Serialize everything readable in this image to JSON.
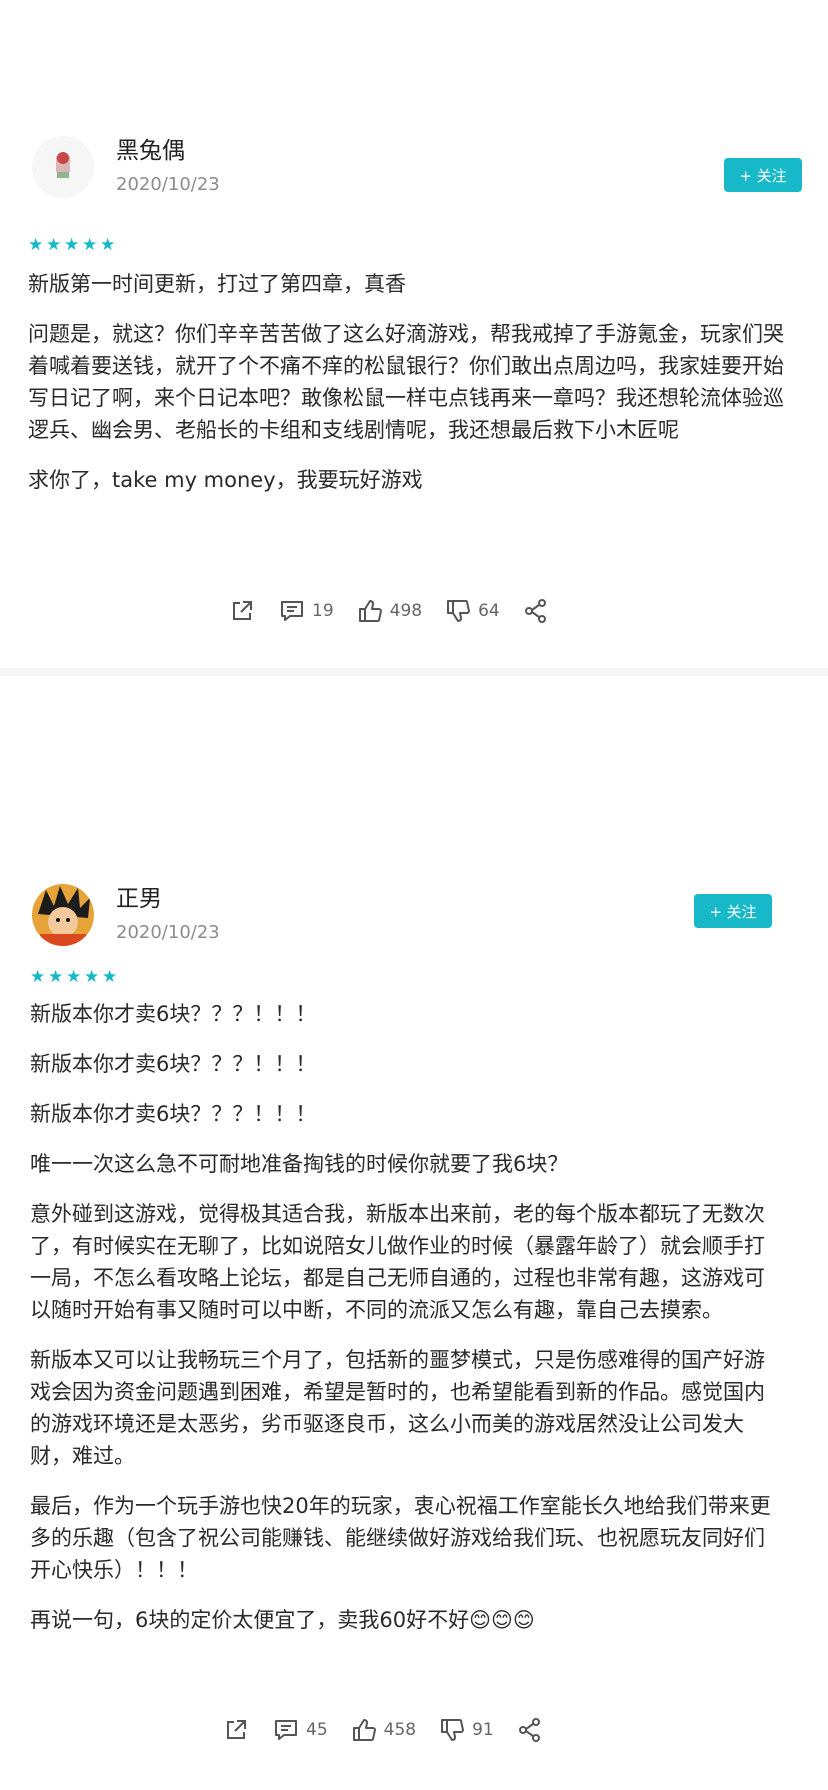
{
  "reviews": [
    {
      "author": "黑兔偶",
      "date": "2020/10/23",
      "follow_label": "+ 关注",
      "rating": 5,
      "paragraphs": [
        "新版第一时间更新，打过了第四章，真香",
        "问题是，就这？你们辛辛苦苦做了这么好滴游戏，帮我戒掉了手游氪金，玩家们哭着喊着要送钱，就开了个不痛不痒的松鼠银行？你们敢出点周边吗，我家娃要开始写日记了啊，来个日记本吧？敢像松鼠一样屯点钱再来一章吗？我还想轮流体验巡逻兵、幽会男、老船长的卡组和支线剧情呢，我还想最后救下小木匠呢",
        "求你了，take my money，我要玩好游戏"
      ],
      "stats": {
        "comments": "19",
        "likes": "498",
        "dislikes": "64"
      }
    },
    {
      "author": "正男",
      "date": "2020/10/23",
      "follow_label": "+ 关注",
      "rating": 5,
      "paragraphs": [
        "新版本你才卖6块？？？！！！",
        "新版本你才卖6块？？？！！！",
        "新版本你才卖6块？？？！！！",
        "唯一一次这么急不可耐地准备掏钱的时候你就要了我6块？",
        "意外碰到这游戏，觉得极其适合我，新版本出来前，老的每个版本都玩了无数次了，有时候实在无聊了，比如说陪女儿做作业的时候（暴露年龄了）就会顺手打一局，不怎么看攻略上论坛，都是自己无师自通的，过程也非常有趣，这游戏可以随时开始有事又随时可以中断，不同的流派又怎么有趣，靠自己去摸索。",
        "新版本又可以让我畅玩三个月了，包括新的噩梦模式，只是伤感难得的国产好游戏会因为资金问题遇到困难，希望是暂时的，也希望能看到新的作品。感觉国内的游戏环境还是太恶劣，劣币驱逐良币，这么小而美的游戏居然没让公司发大财，难过。",
        "最后，作为一个玩手游也快20年的玩家，衷心祝福工作室能长久地给我们带来更多的乐趣（包含了祝公司能赚钱、能继续做好游戏给我们玩、也祝愿玩友同好们开心快乐）！！！",
        "再说一句，6块的定价太便宜了，卖我60好不好😊😊😊"
      ],
      "stats": {
        "comments": "45",
        "likes": "458",
        "dislikes": "91"
      }
    }
  ],
  "colors": {
    "accent": "#17b9c9"
  },
  "icons": [
    "share-icon",
    "comment-icon",
    "like-icon",
    "dislike-icon",
    "forward-icon",
    "star-icon"
  ]
}
